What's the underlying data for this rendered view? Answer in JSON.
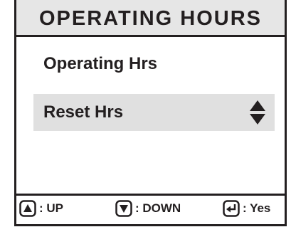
{
  "header": {
    "title": "OPERATING HOURS"
  },
  "menu": {
    "items": [
      {
        "label": "Operating Hrs",
        "selected": false
      },
      {
        "label": "Reset Hrs",
        "selected": true
      }
    ],
    "selected_indicator_icon": "up-down-arrows-icon"
  },
  "footer": {
    "hints": [
      {
        "icon": "up-key-icon",
        "label": ": UP"
      },
      {
        "icon": "down-key-icon",
        "label": ": DOWN"
      },
      {
        "icon": "enter-key-icon",
        "label": ": Yes"
      }
    ]
  },
  "colors": {
    "title_background": "#e6e6e6",
    "selected_background": "#e0e0e0",
    "ink": "#231f20"
  }
}
